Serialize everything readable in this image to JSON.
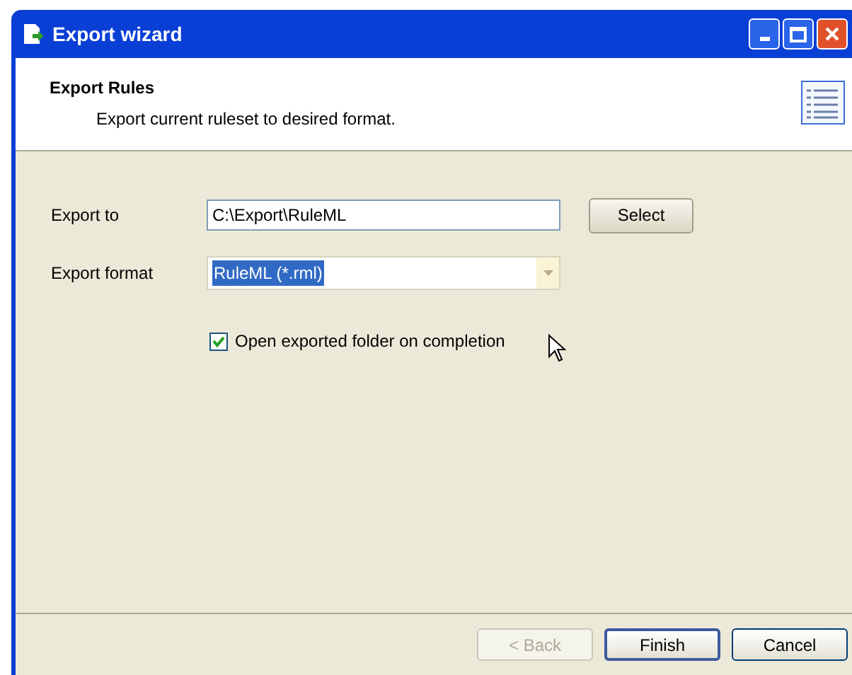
{
  "window": {
    "title": "Export wizard"
  },
  "header": {
    "title": "Export Rules",
    "subtitle": "Export current ruleset to desired format."
  },
  "fields": [
    {
      "kind": "text",
      "label": "Export to",
      "value": "C:\\Export\\RuleML",
      "button": "Select"
    },
    {
      "kind": "combo",
      "label": "Export format",
      "value": "RuleML (*.rml)",
      "selected": true
    }
  ],
  "option": {
    "label": "Open exported folder on completion",
    "checked": true
  },
  "buttons": [
    {
      "label": "< Back",
      "disabled": true,
      "default": false
    },
    {
      "label": "Finish",
      "disabled": false,
      "default": true
    },
    {
      "label": "Cancel",
      "disabled": false,
      "default": false
    }
  ]
}
